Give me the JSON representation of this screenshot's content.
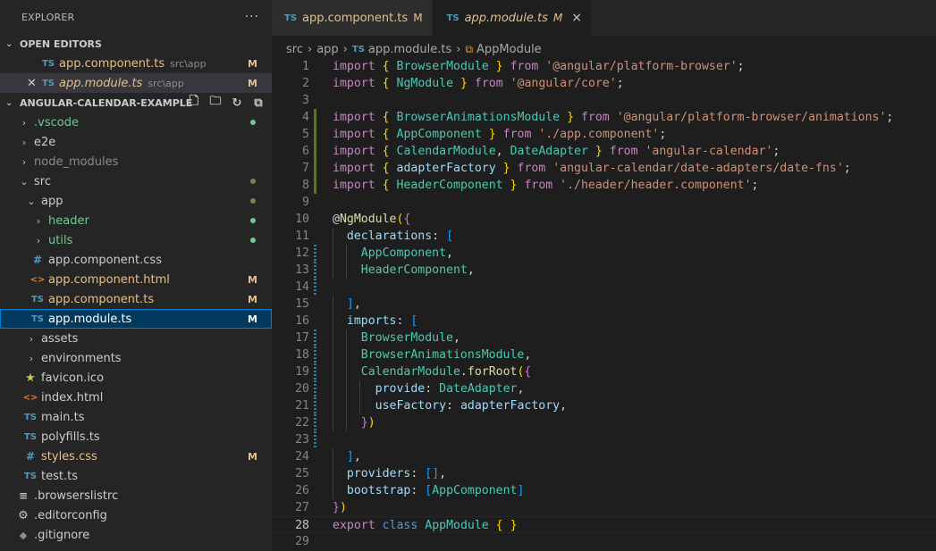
{
  "explorer": {
    "title": "EXPLORER",
    "more": "···",
    "open_editors": {
      "title": "OPEN EDITORS",
      "items": [
        {
          "icon": "TS",
          "name": "app.component.ts",
          "path": "src\\app",
          "status": "M"
        },
        {
          "icon": "TS",
          "name": "app.module.ts",
          "path": "src\\app",
          "status": "M"
        }
      ]
    },
    "project": {
      "title": "ANGULAR-CALENDAR-EXAMPLE",
      "items": [
        {
          "twisty": "›",
          "name": ".vscode"
        },
        {
          "twisty": "›",
          "name": "e2e"
        },
        {
          "twisty": "›",
          "name": "node_modules"
        },
        {
          "twisty": "⌄",
          "name": "src"
        },
        {
          "twisty": "⌄",
          "name": "app"
        },
        {
          "twisty": "›",
          "name": "header"
        },
        {
          "twisty": "›",
          "name": "utils"
        },
        {
          "icon": "#",
          "name": "app.component.css"
        },
        {
          "icon": "<>",
          "name": "app.component.html",
          "status": "M"
        },
        {
          "icon": "TS",
          "name": "app.component.ts",
          "status": "M"
        },
        {
          "icon": "TS",
          "name": "app.module.ts",
          "status": "M"
        },
        {
          "twisty": "›",
          "name": "assets"
        },
        {
          "twisty": "›",
          "name": "environments"
        },
        {
          "icon": "★",
          "name": "favicon.ico"
        },
        {
          "icon": "<>",
          "name": "index.html"
        },
        {
          "icon": "TS",
          "name": "main.ts"
        },
        {
          "icon": "TS",
          "name": "polyfills.ts"
        },
        {
          "icon": "#",
          "name": "styles.css",
          "status": "M"
        },
        {
          "icon": "TS",
          "name": "test.ts"
        },
        {
          "icon": "≡",
          "name": ".browserslistrc"
        },
        {
          "icon": "⚙",
          "name": ".editorconfig"
        },
        {
          "icon": "◆",
          "name": ".gitignore"
        }
      ]
    }
  },
  "tabs": [
    {
      "icon": "TS",
      "label": "app.component.ts",
      "status": "M"
    },
    {
      "icon": "TS",
      "label": "app.module.ts",
      "status": "M",
      "close": "×"
    }
  ],
  "breadcrumb": {
    "parts": [
      "src",
      "app",
      "app.module.ts",
      "AppModule"
    ],
    "sep": "›",
    "file_icon": "TS",
    "symbol_icon": "⧉"
  },
  "colors": {
    "accent": "#007fd4",
    "modified": "#e2c08d",
    "untracked": "#73c991",
    "added_gutter": "#587c0c",
    "modified_gutter": "#1b81a8"
  },
  "code": {
    "current_line": 28,
    "lines": [
      "import { BrowserModule } from '@angular/platform-browser';",
      "import { NgModule } from '@angular/core';",
      "",
      "import { BrowserAnimationsModule } from '@angular/platform-browser/animations';",
      "import { AppComponent } from './app.component';",
      "import { CalendarModule, DateAdapter } from 'angular-calendar';",
      "import { adapterFactory } from 'angular-calendar/date-adapters/date-fns';",
      "import { HeaderComponent } from './header/header.component';",
      "",
      "@NgModule({",
      "  declarations: [",
      "    AppComponent,",
      "    HeaderComponent,",
      "",
      "  ],",
      "  imports: [",
      "    BrowserModule,",
      "    BrowserAnimationsModule,",
      "    CalendarModule.forRoot({",
      "      provide: DateAdapter,",
      "      useFactory: adapterFactory,",
      "    })",
      "",
      "  ],",
      "  providers: [],",
      "  bootstrap: [AppComponent]",
      "})",
      "export class AppModule { }",
      ""
    ]
  }
}
